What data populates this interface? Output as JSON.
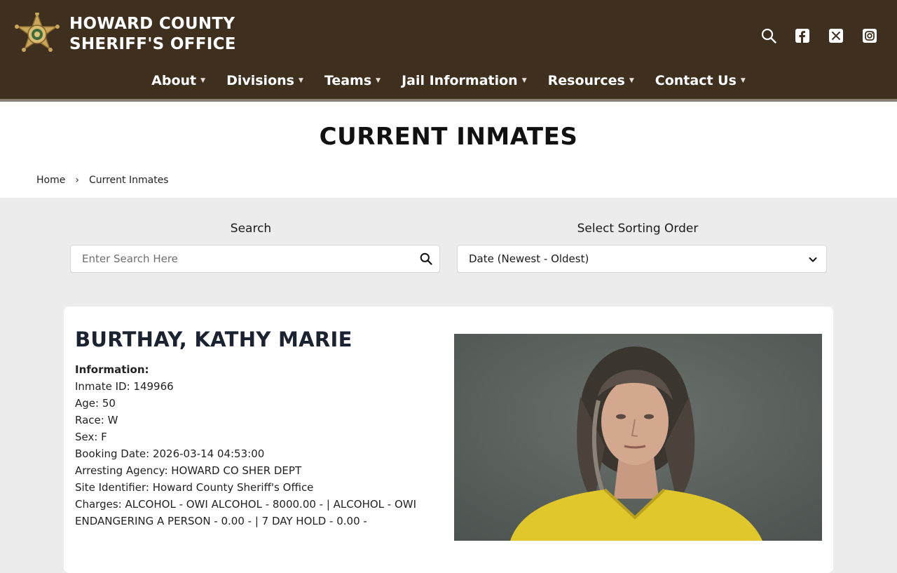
{
  "header": {
    "org_line1": "HOWARD COUNTY",
    "org_line2": "SHERIFF'S OFFICE",
    "icons": [
      "search-icon",
      "facebook-icon",
      "x-twitter-icon",
      "instagram-icon"
    ],
    "background": "#3e2f1f"
  },
  "nav": {
    "items": [
      {
        "label": "About"
      },
      {
        "label": "Divisions"
      },
      {
        "label": "Teams"
      },
      {
        "label": "Jail Information"
      },
      {
        "label": "Resources"
      },
      {
        "label": "Contact Us"
      }
    ]
  },
  "page": {
    "title": "CURRENT INMATES",
    "breadcrumb": {
      "home": "Home",
      "separator": "›",
      "current": "Current Inmates"
    }
  },
  "filters": {
    "search_label": "Search",
    "search_placeholder": "Enter Search Here",
    "search_value": "",
    "sort_label": "Select Sorting Order",
    "sort_value": "Date (Newest - Oldest)"
  },
  "inmate": {
    "name": "BURTHAY, KATHY MARIE",
    "info_heading": "Information:",
    "inmate_id": "Inmate ID: 149966",
    "age": "Age: 50",
    "race": "Race: W",
    "sex": "Sex: F",
    "booking_date": "Booking Date: 2026-03-14 04:53:00",
    "arresting_agency": "Arresting Agency: HOWARD CO SHER DEPT",
    "site_identifier": "Site Identifier: Howard County Sheriff's Office",
    "charges": "Charges: ALCOHOL - OWI ALCOHOL - 8000.00 - | ALCOHOL - OWI ENDANGERING A PERSON - 0.00 - | 7 DAY HOLD - 0.00 -"
  }
}
